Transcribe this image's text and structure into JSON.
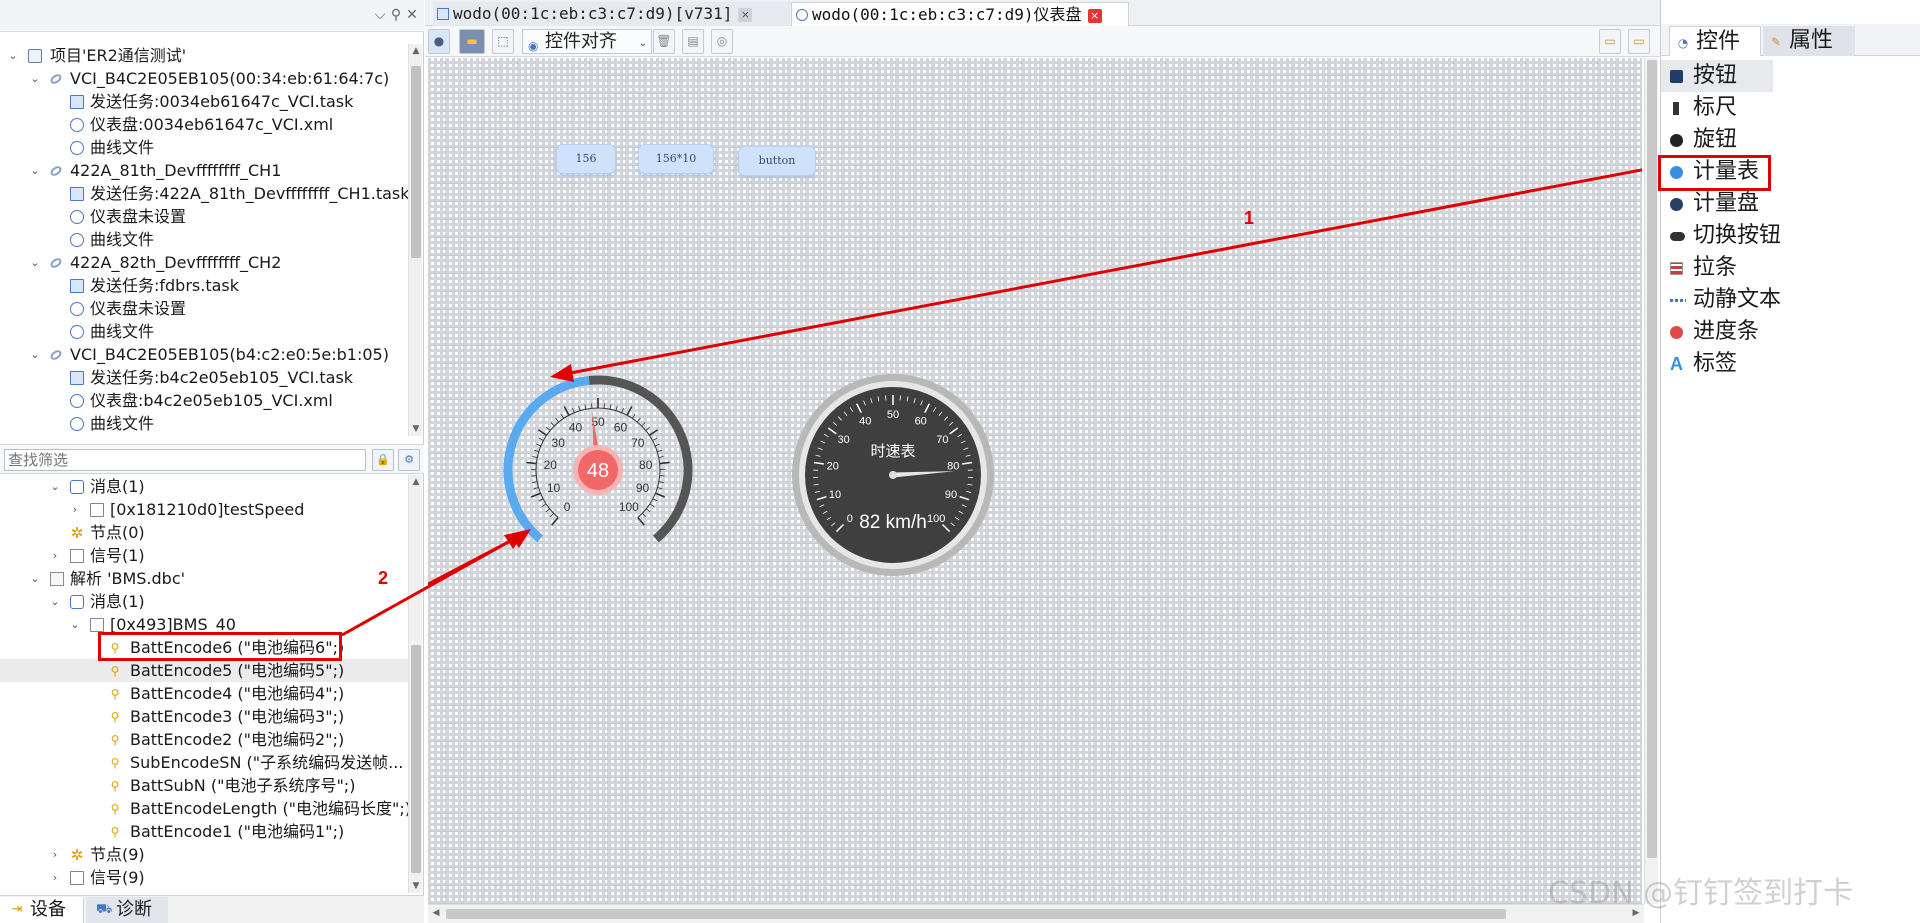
{
  "project_tree": {
    "rows": [
      {
        "text": "项目'ER2通信测试'",
        "icon": "folder-icon",
        "expanded": true
      },
      {
        "text": "VCI_B4C2E05EB105(00:34:eb:61:64:7c)",
        "icon": "link-icon",
        "expanded": true
      },
      {
        "text": "发送任务:0034eb61647c_VCI.task",
        "icon": "task-file-icon"
      },
      {
        "text": "仪表盘:0034eb61647c_VCI.xml",
        "icon": "dashboard-icon"
      },
      {
        "text": "曲线文件",
        "icon": "curve-file-icon"
      },
      {
        "text": "422A_81th_Devffffffff_CH1",
        "icon": "link-icon",
        "expanded": true
      },
      {
        "text": "发送任务:422A_81th_Devffffffff_CH1.task",
        "icon": "task-file-icon"
      },
      {
        "text": "仪表盘未设置",
        "icon": "dashboard-icon"
      },
      {
        "text": "曲线文件",
        "icon": "curve-file-icon"
      },
      {
        "text": "422A_82th_Devffffffff_CH2",
        "icon": "link-icon",
        "expanded": true
      },
      {
        "text": "发送任务:fdbrs.task",
        "icon": "task-file-icon"
      },
      {
        "text": "仪表盘未设置",
        "icon": "dashboard-icon"
      },
      {
        "text": "曲线文件",
        "icon": "curve-file-icon"
      },
      {
        "text": "VCI_B4C2E05EB105(b4:c2:e0:5e:b1:05)",
        "icon": "link-icon",
        "expanded": true
      },
      {
        "text": "发送任务:b4c2e05eb105_VCI.task",
        "icon": "task-file-icon"
      },
      {
        "text": "仪表盘:b4c2e05eb105_VCI.xml",
        "icon": "dashboard-icon"
      },
      {
        "text": "曲线文件",
        "icon": "curve-file-icon"
      }
    ]
  },
  "filter": {
    "placeholder": "查找筛选"
  },
  "signal_tree": {
    "rows": [
      {
        "text": "消息(1)",
        "icon": "message-icon",
        "expander": "down"
      },
      {
        "text": "[0x181210d0]testSpeed",
        "icon": "envelope-icon",
        "expander": "right"
      },
      {
        "text": "节点(0)",
        "icon": "node-icon",
        "expander": ""
      },
      {
        "text": "信号(1)",
        "icon": "envelope-icon",
        "expander": "right"
      },
      {
        "text": "解析 'BMS.dbc'",
        "icon": "dbc-file-icon",
        "expander": "down"
      },
      {
        "text": "消息(1)",
        "icon": "message-icon",
        "expander": "down"
      },
      {
        "text": "[0x493]BMS_40",
        "icon": "envelope-icon",
        "expander": "down"
      },
      {
        "text": "BattEncode6 (\"电池编码6\";)",
        "icon": "signal-icon",
        "expander": ""
      },
      {
        "text": "BattEncode5 (\"电池编码5\";)",
        "icon": "signal-icon",
        "expander": ""
      },
      {
        "text": "BattEncode4 (\"电池编码4\";)",
        "icon": "signal-icon",
        "expander": ""
      },
      {
        "text": "BattEncode3 (\"电池编码3\";)",
        "icon": "signal-icon",
        "expander": ""
      },
      {
        "text": "BattEncode2 (\"电池编码2\";)",
        "icon": "signal-icon",
        "expander": ""
      },
      {
        "text": "SubEncodeSN (\"子系统编码发送帧...",
        "icon": "signal-icon",
        "expander": ""
      },
      {
        "text": "BattSubN (\"电池子系统序号\";)",
        "icon": "signal-icon",
        "expander": ""
      },
      {
        "text": "BattEncodeLength (\"电池编码长度\";)",
        "icon": "signal-icon",
        "expander": ""
      },
      {
        "text": "BattEncode1 (\"电池编码1\";)",
        "icon": "signal-icon",
        "expander": ""
      },
      {
        "text": "节点(9)",
        "icon": "node-icon",
        "expander": "right"
      },
      {
        "text": "信号(9)",
        "icon": "envelope-icon",
        "expander": "right"
      }
    ]
  },
  "bottom_tabs": [
    {
      "label": "设备",
      "icon": "device-icon"
    },
    {
      "label": "诊断",
      "icon": "diagnosis-icon"
    }
  ],
  "doc_tabs": [
    {
      "label": "wodo(00:1c:eb:c3:c7:d9)[v731]",
      "close": "×"
    },
    {
      "label": "wodo(00:1c:eb:c3:c7:d9)仪表盘",
      "close": "×"
    }
  ],
  "toolbar": {
    "align_label": "控件对齐"
  },
  "canvas": {
    "buttons": [
      "156",
      "156*10",
      "button"
    ],
    "meter": {
      "value": "48",
      "ticks": [
        "0",
        "10",
        "20",
        "30",
        "40",
        "50",
        "60",
        "70",
        "80",
        "90",
        "100"
      ],
      "colors": {
        "arc_low": "#5aaaf0",
        "arc_high": "#555555",
        "center": "#f26868"
      }
    },
    "speedometer": {
      "title": "时速表",
      "readout": "82 km/h",
      "ticks": [
        "0",
        "10",
        "20",
        "30",
        "40",
        "50",
        "60",
        "70",
        "80",
        "90",
        "100"
      ],
      "value": 82
    },
    "annotations": {
      "arrow1_label": "1",
      "arrow2_label": "2",
      "color": "#e00000"
    },
    "watermark": "CSDN @钉钉签到打卡"
  },
  "right_panel": {
    "tabs": [
      {
        "label": "控件",
        "icon": "controls-icon"
      },
      {
        "label": "属性",
        "icon": "properties-icon"
      }
    ],
    "controls": [
      {
        "label": "按钮",
        "icon": "button-icon"
      },
      {
        "label": "标尺",
        "icon": "ruler-icon"
      },
      {
        "label": "旋钮",
        "icon": "knob-icon"
      },
      {
        "label": "计量表",
        "icon": "meter-icon"
      },
      {
        "label": "计量盘",
        "icon": "dial-icon"
      },
      {
        "label": "切换按钮",
        "icon": "toggle-icon"
      },
      {
        "label": "拉条",
        "icon": "slider-icon"
      },
      {
        "label": "动静文本",
        "icon": "text-icon"
      },
      {
        "label": "进度条",
        "icon": "progress-icon"
      },
      {
        "label": "标签",
        "icon": "label-icon"
      }
    ]
  }
}
